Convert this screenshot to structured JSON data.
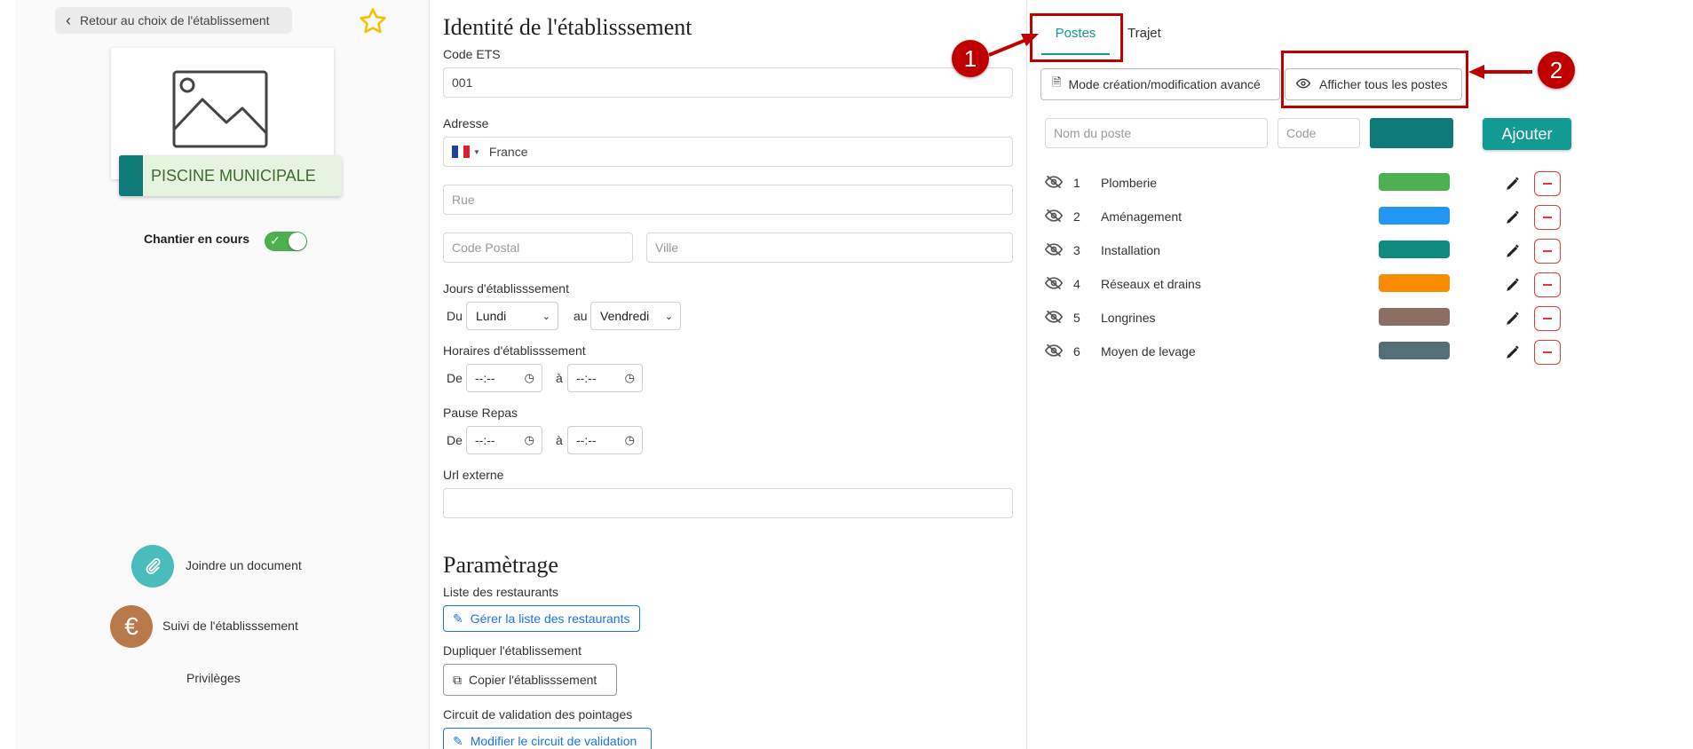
{
  "left": {
    "back_label": "Retour au choix de l'établissement",
    "establishment_name": "PISCINE MUNICIPALE",
    "chantier_label": "Chantier en cours",
    "chantier_on": true,
    "actions": [
      {
        "label": "Joindre un document",
        "icon": "paperclip-icon",
        "color": "#4bbcbc"
      },
      {
        "label": "Suivi de l'établisssement",
        "icon": "euro-icon",
        "color": "#b87a4b"
      },
      {
        "label": "Privilèges",
        "icon": "",
        "color": ""
      }
    ]
  },
  "identity": {
    "title": "Identité de l'établisssement",
    "code_label": "Code ETS",
    "code_value": "001",
    "address_label": "Adresse",
    "country_value": "France",
    "street_placeholder": "Rue",
    "postal_placeholder": "Code Postal",
    "city_placeholder": "Ville",
    "days_label": "Jours d'établisssement",
    "days_from_label": "Du",
    "days_from_value": "Lundi",
    "days_to_label": "au",
    "days_to_value": "Vendredi",
    "hours_label": "Horaires d'établisssement",
    "hours_from_label": "De",
    "hours_to_label": "à",
    "time_placeholder": "--:--",
    "break_label": "Pause Repas",
    "break_from_label": "De",
    "break_to_label": "à",
    "url_label": "Url externe"
  },
  "settings": {
    "title": "Paramètrage",
    "restaurants_label": "Liste des restaurants",
    "restaurants_button": "Gérer la liste des restaurants",
    "duplicate_label": "Dupliquer l'établissement",
    "duplicate_button": "Copier l'établisssement",
    "circuit_label": "Circuit de validation des pointages",
    "circuit_button": "Modifier le circuit de validation"
  },
  "right": {
    "tabs": [
      {
        "label": "Postes",
        "active": true
      },
      {
        "label": "Trajet",
        "active": false
      }
    ],
    "advanced_button": "Mode création/modification avancé",
    "show_all_button": "Afficher tous les postes",
    "name_placeholder": "Nom du poste",
    "code_placeholder": "Code",
    "new_color": "#0f7b78",
    "add_button": "Ajouter",
    "postes": [
      {
        "num": "1",
        "name": "Plomberie",
        "color": "#4caf50"
      },
      {
        "num": "2",
        "name": "Aménagement",
        "color": "#2196f3"
      },
      {
        "num": "3",
        "name": "Installation",
        "color": "#0f8a7e"
      },
      {
        "num": "4",
        "name": "Réseaux et drains",
        "color": "#fb8c00"
      },
      {
        "num": "5",
        "name": "Longrines",
        "color": "#8d6e63"
      },
      {
        "num": "6",
        "name": "Moyen de levage",
        "color": "#546e7a"
      }
    ]
  },
  "annotations": [
    {
      "number": "1"
    },
    {
      "number": "2"
    }
  ],
  "colors": {
    "accent": "#129b93",
    "annotation": "#c00000",
    "danger": "#e53935"
  }
}
